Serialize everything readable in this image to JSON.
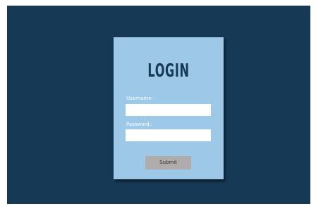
{
  "login": {
    "title": "LOGIN",
    "username_label": "Username :",
    "username_value": "",
    "password_label": "Password :",
    "password_value": "",
    "submit_label": "Submit"
  },
  "colors": {
    "background": "#163a56",
    "card": "#9ec8e8",
    "title": "#163a56",
    "button": "#b0acab"
  }
}
